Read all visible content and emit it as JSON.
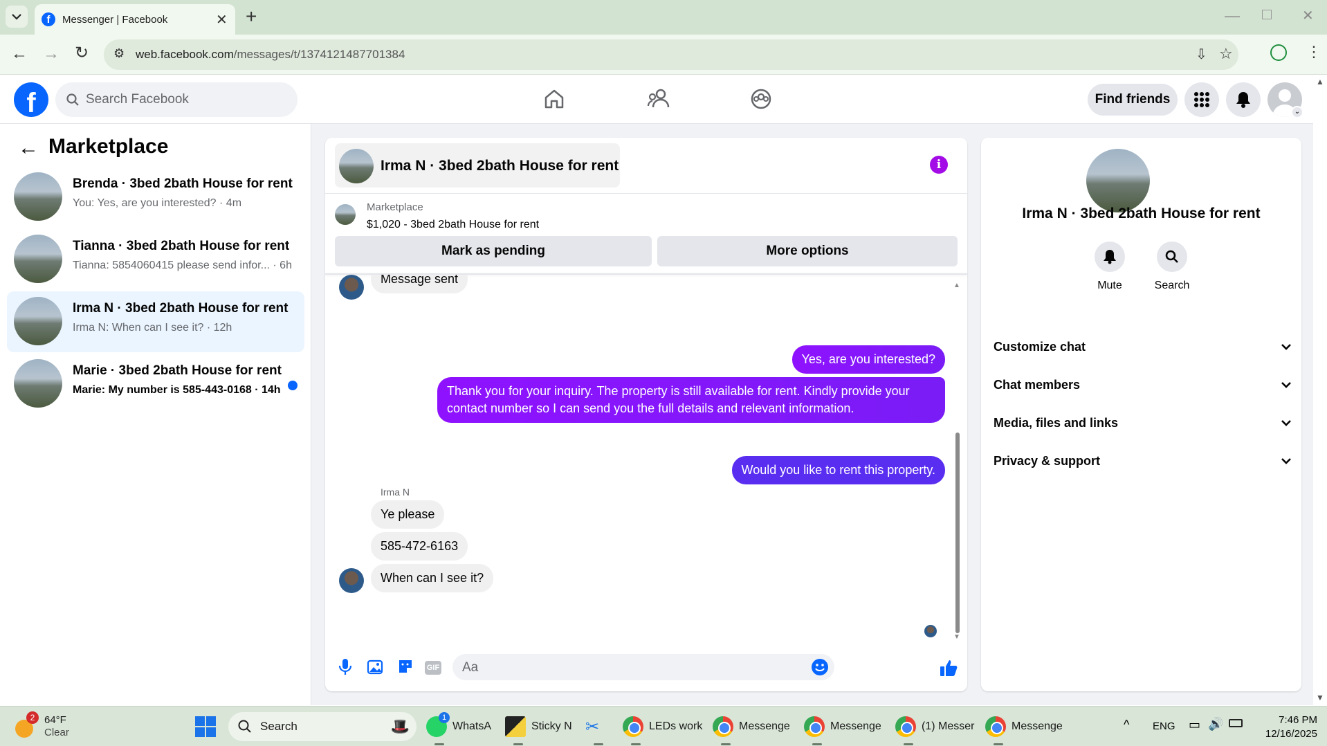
{
  "browser": {
    "tab_title": "Messenger | Facebook",
    "url_domain": "web.facebook.com",
    "url_path": "/messages/t/1374121487701384"
  },
  "fb_header": {
    "search_placeholder": "Search Facebook",
    "find_friends": "Find friends"
  },
  "left_panel": {
    "title": "Marketplace",
    "conversations": [
      {
        "name": "Brenda · 3bed 2bath House for rent",
        "preview": "You: Yes, are you interested? · 4m",
        "unread": false
      },
      {
        "name": "Tianna · 3bed 2bath House for rent",
        "preview": "Tianna: 5854060415 please send infor... · 6h",
        "unread": false
      },
      {
        "name": "Irma N · 3bed 2bath House for rent",
        "preview": "Irma N: When can I see it? · 12h",
        "unread": false
      },
      {
        "name": "Marie · 3bed 2bath House for rent",
        "preview": "Marie: My number is 585-443-0168 · 14h",
        "unread": true
      }
    ]
  },
  "chat": {
    "header_title": "Irma N · 3bed 2bath House for rent",
    "listing_label": "Marketplace",
    "listing_text": "$1,020 - 3bed 2bath House for rent",
    "mark_pending": "Mark as pending",
    "more_options": "More options",
    "partial_message": "Message sent",
    "messages": [
      {
        "from": "me",
        "text": "Yes, are you interested?"
      },
      {
        "from": "me",
        "text": "Thank you for your inquiry. The property is still available for rent. Kindly provide your contact number so I can send you the full details and relevant information."
      },
      {
        "from": "me",
        "text": "Would you like to rent this property."
      },
      {
        "from": "them",
        "sender": "Irma N",
        "text": "Ye please"
      },
      {
        "from": "them",
        "text": "585-472-6163"
      },
      {
        "from": "them",
        "text": "When can I see it?"
      }
    ],
    "composer_placeholder": "Aa"
  },
  "info_panel": {
    "title": "Irma N · 3bed 2bath House for rent",
    "mute": "Mute",
    "search": "Search",
    "sections": [
      "Customize chat",
      "Chat members",
      "Media, files and links",
      "Privacy & support"
    ]
  },
  "taskbar": {
    "weather_temp": "64°F",
    "weather_desc": "Clear",
    "weather_badge": "2",
    "search": "Search",
    "apps": [
      {
        "label": "WhatsA",
        "badge": "1"
      },
      {
        "label": "Sticky N"
      },
      {
        "label": "LEDs work"
      },
      {
        "label": "Messenge"
      },
      {
        "label": "Messenge"
      },
      {
        "label": "(1) Messer"
      },
      {
        "label": "Messenge"
      }
    ],
    "lang": "ENG",
    "time": "7:46 PM",
    "date": "12/16/2025"
  },
  "colors": {
    "fb_blue": "#0866ff",
    "purple": "#8f12ff",
    "unread_dot": "#0866ff"
  }
}
